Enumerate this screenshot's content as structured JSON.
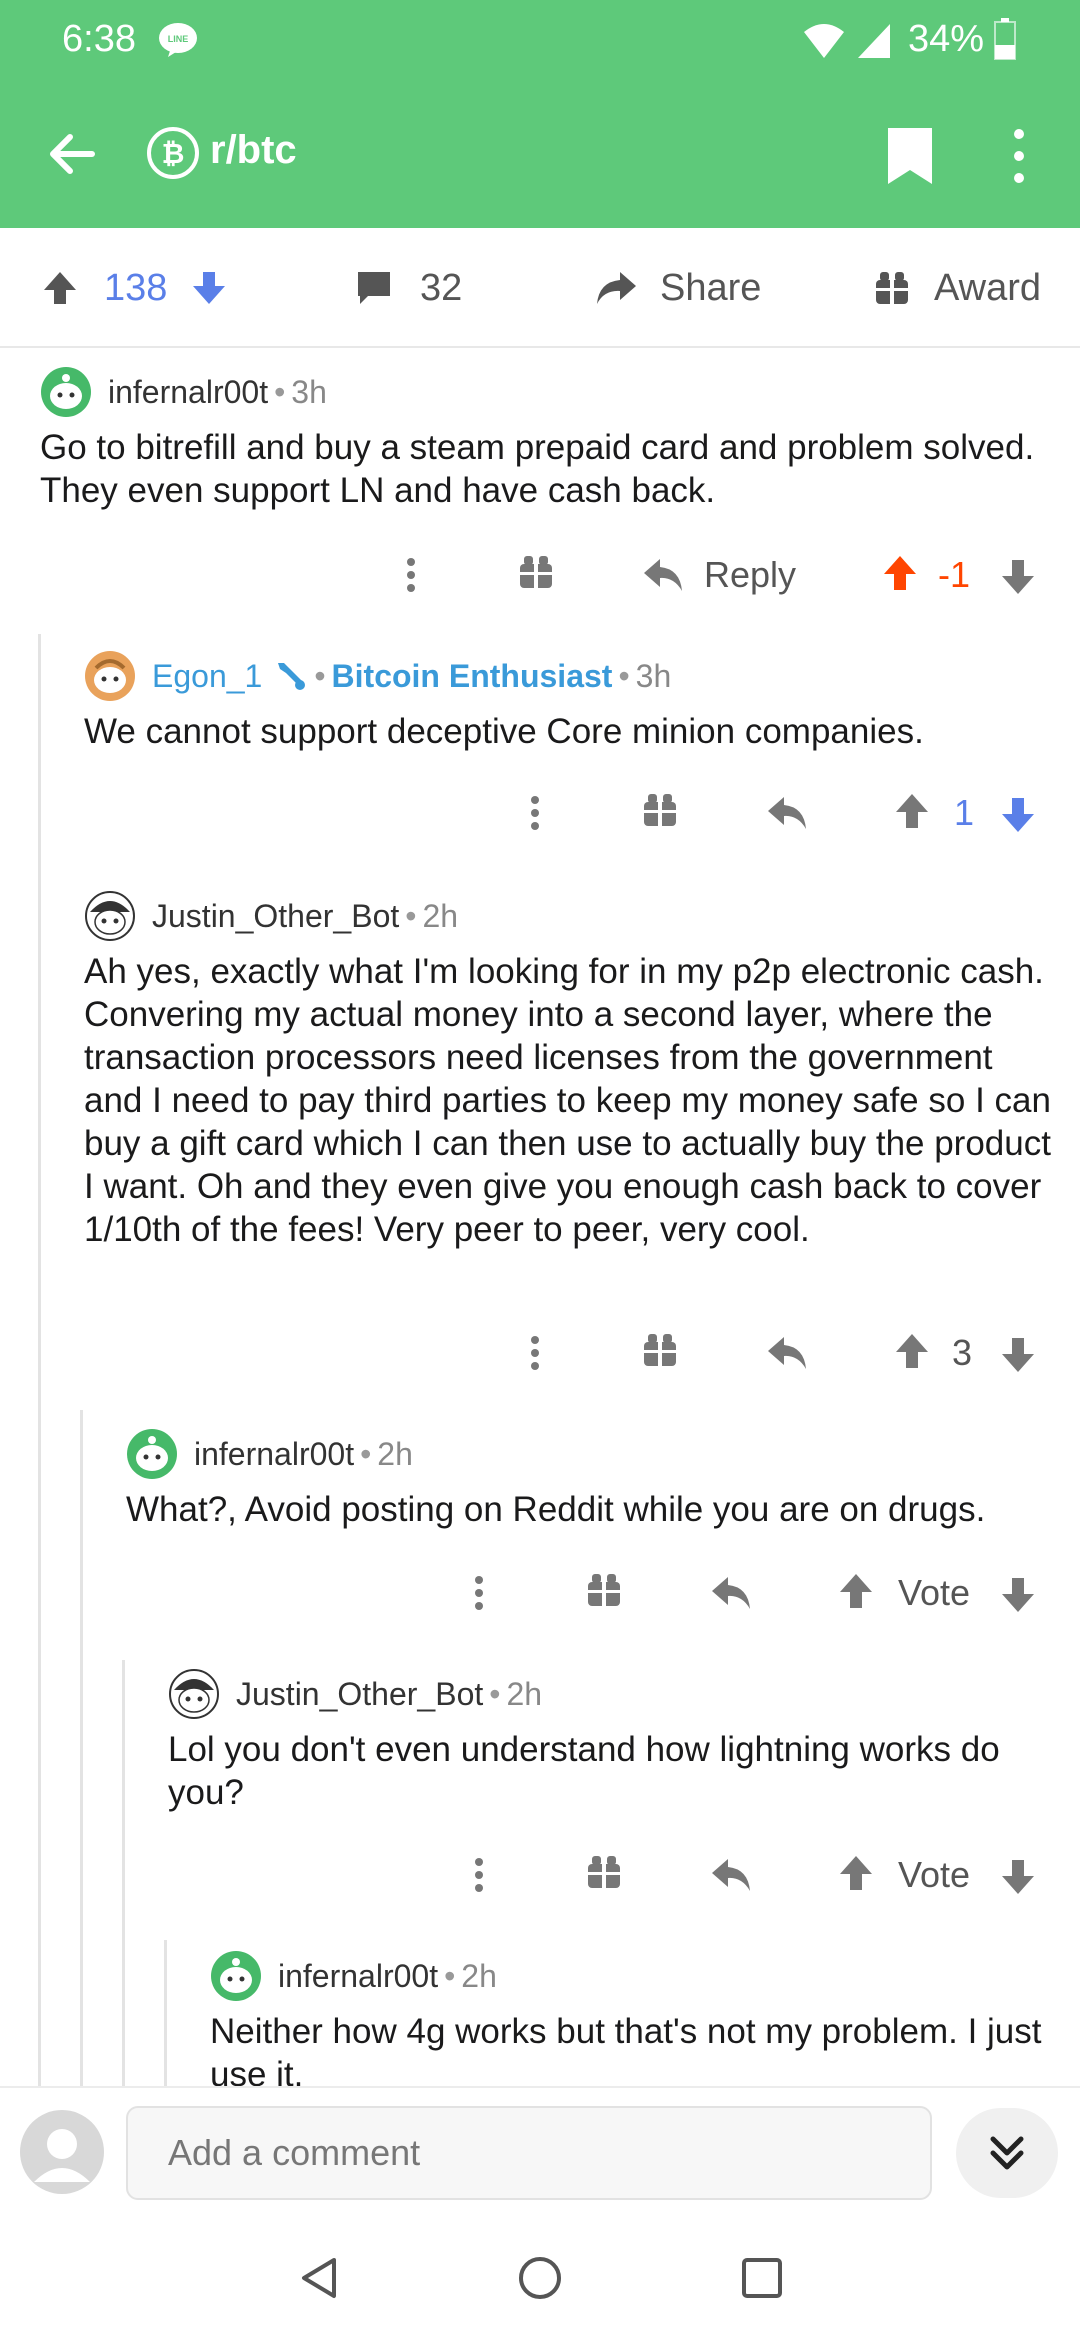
{
  "status": {
    "time": "6:38",
    "battery": "34%",
    "icons": [
      "line-icon",
      "wifi-icon",
      "signal-icon",
      "battery-icon"
    ]
  },
  "appbar": {
    "subreddit": "r/btc",
    "icons": [
      "back-arrow-icon",
      "bitcoin-icon",
      "bookmark-icon",
      "more-vert-icon"
    ]
  },
  "post_actions": {
    "upvotes": "138",
    "comments": "32",
    "share": "Share",
    "award": "Award"
  },
  "comments": [
    {
      "author": "infernalr00t",
      "age": "3h",
      "text": "Go to bitrefill and buy a steam prepaid card and problem solved. They even support LN and have cash back.",
      "reply": "Reply",
      "score": "-1",
      "vote_state": "upvoted"
    },
    {
      "author": "Egon_1",
      "flair": "Bitcoin Enthusiast",
      "age": "3h",
      "text": "We cannot support deceptive Core minion companies.",
      "score": "1",
      "vote_state": "none"
    },
    {
      "author": "Justin_Other_Bot",
      "age": "2h",
      "text": "Ah yes, exactly what I'm looking for in my p2p electronic cash. Convering my actual money into a second layer, where the transaction processors need licenses from the government and I need to pay third parties to keep my money safe so I can buy a gift card which I can then use to actually buy the product I want. Oh and they even give you enough cash back to cover 1/10th of the fees! Very peer to peer, very cool.",
      "score": "3",
      "vote_state": "none"
    },
    {
      "author": "infernalr00t",
      "age": "2h",
      "text": "What?, Avoid posting on Reddit while you are on drugs.",
      "score": "Vote",
      "vote_state": "none"
    },
    {
      "author": "Justin_Other_Bot",
      "age": "2h",
      "text": "Lol you don't even understand how lightning works do you?",
      "score": "Vote",
      "vote_state": "none"
    },
    {
      "author": "infernalr00t",
      "age": "2h",
      "text": "Neither how 4g works but that's not my problem. I just use it."
    }
  ],
  "comment_bar": {
    "placeholder": "Add a comment"
  },
  "colors": {
    "header_green": "#5ec97a",
    "upvote_orange": "#ff4500",
    "vote_blue": "#5a7fe8",
    "flair_blue": "#3a9ad9"
  }
}
